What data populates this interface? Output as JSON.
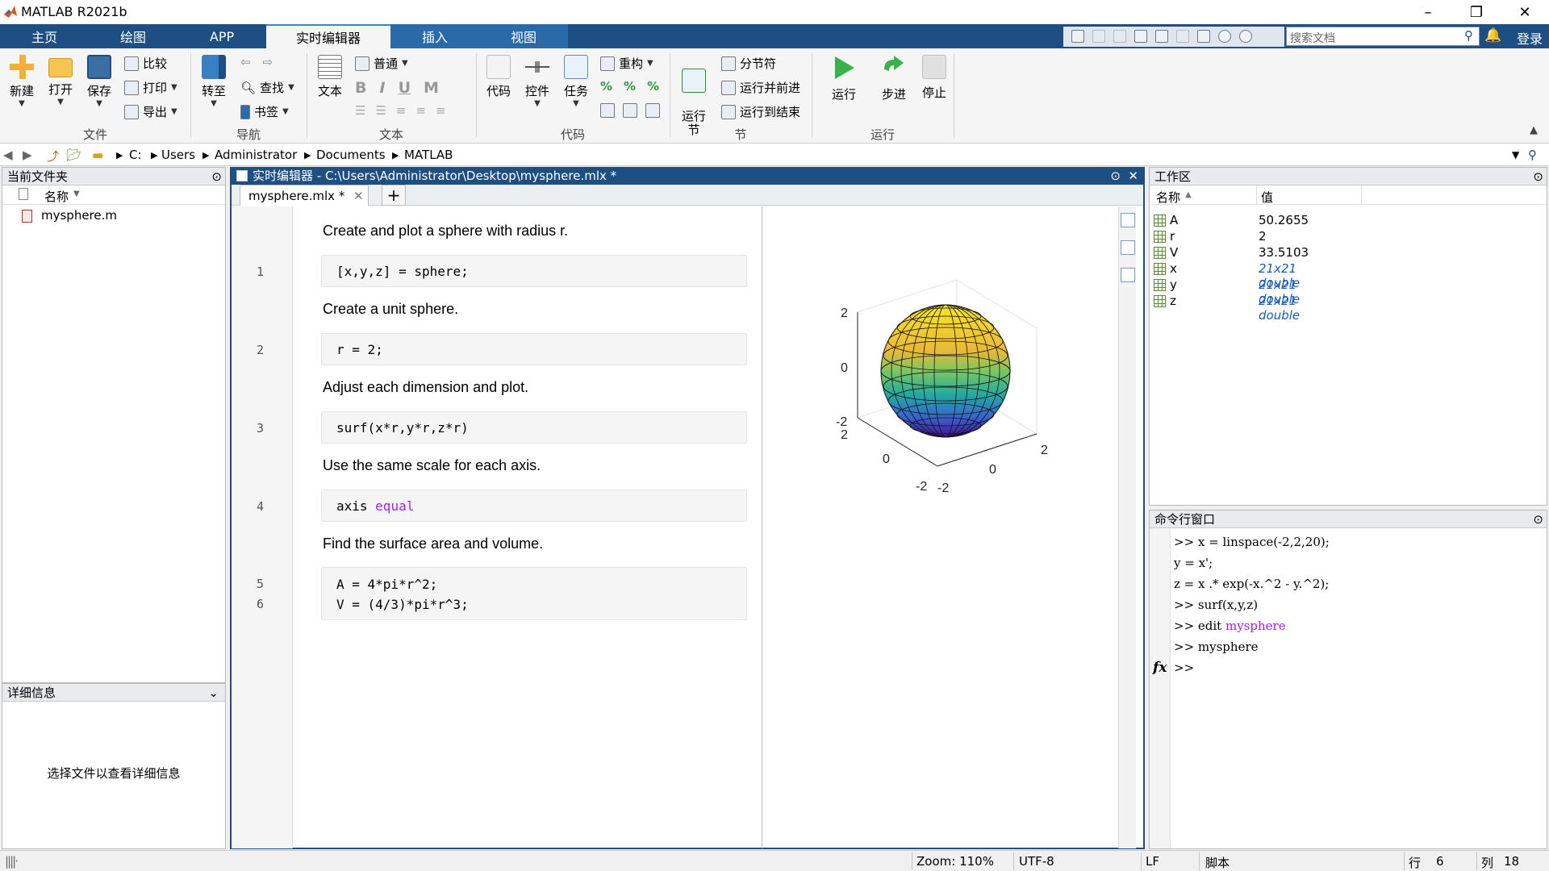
{
  "window": {
    "title": "MATLAB R2021b"
  },
  "tabs": [
    "主页",
    "绘图",
    "APP",
    "实时编辑器",
    "插入",
    "视图"
  ],
  "search": {
    "placeholder": "搜索文档"
  },
  "login_label": "登录",
  "ribbon": {
    "file": {
      "group": "文件",
      "new": "新建",
      "open": "打开",
      "save": "保存",
      "compare": "比较",
      "print": "打印",
      "export": "导出"
    },
    "nav": {
      "group": "导航",
      "goto": "转至",
      "find": "查找",
      "bookmark": "书签"
    },
    "text": {
      "group": "文本",
      "text_btn": "文本",
      "style": "普通",
      "bold": "B",
      "italic": "I",
      "underline": "U",
      "mono": "M"
    },
    "code": {
      "group": "代码",
      "code": "代码",
      "control": "控件",
      "task": "任务",
      "refactor": "重构"
    },
    "section": {
      "group": "节",
      "run_section": "运行\n节",
      "section_break": "分节符",
      "run_advance": "运行并前进",
      "run_to_end": "运行到结束"
    },
    "run": {
      "group": "运行",
      "run": "运行",
      "step": "步进",
      "stop": "停止"
    }
  },
  "address": {
    "drive": "C:",
    "parts": [
      "Users",
      "Administrator",
      "Documents",
      "MATLAB"
    ]
  },
  "current_folder": {
    "title": "当前文件夹",
    "col_name": "名称",
    "files": [
      "mysphere.m"
    ],
    "details_title": "详细信息",
    "details_msg": "选择文件以查看详细信息"
  },
  "editor": {
    "title": "实时编辑器 - C:\\Users\\Administrator\\Desktop\\mysphere.mlx *",
    "tab": "mysphere.mlx *",
    "cells": [
      {
        "text": "Create and plot a sphere with radius r.",
        "lines": [
          "1"
        ],
        "code": [
          "[x,y,z] = sphere;"
        ]
      },
      {
        "text": "Create a unit sphere.",
        "lines": [
          "2"
        ],
        "code": [
          "r = 2;"
        ]
      },
      {
        "text": "Adjust each dimension and plot.",
        "lines": [
          "3"
        ],
        "code": [
          "surf(x*r,y*r,z*r)"
        ]
      },
      {
        "text": "Use the same scale for each axis.",
        "lines": [
          "4"
        ],
        "code_pre": "axis ",
        "code_kw": "equal"
      },
      {
        "text": "Find the surface area and volume.",
        "lines": [
          "5",
          "6"
        ],
        "code": [
          "A = 4*pi*r^2;",
          "V = (4/3)*pi*r^3;"
        ]
      }
    ],
    "plot_ticks": {
      "z": [
        "2",
        "0",
        "-2"
      ],
      "x": [
        "2",
        "0",
        "-2"
      ],
      "y": [
        "2",
        "0",
        "-2"
      ]
    }
  },
  "workspace": {
    "title": "工作区",
    "col_name": "名称",
    "col_value": "值",
    "vars": [
      {
        "name": "A",
        "value": "50.2655",
        "italic": false
      },
      {
        "name": "r",
        "value": "2",
        "italic": false
      },
      {
        "name": "V",
        "value": "33.5103",
        "italic": false
      },
      {
        "name": "x",
        "value": "21x21 double",
        "italic": true
      },
      {
        "name": "y",
        "value": "21x21 double",
        "italic": true
      },
      {
        "name": "z",
        "value": "21x21 double",
        "italic": true
      }
    ]
  },
  "command": {
    "title": "命令行窗口",
    "lines": [
      ">> x = linspace(-2,2,20);",
      "y = x';",
      "z = x .* exp(-x.^2 - y.^2);",
      ">> surf(x,y,z)",
      ">> edit mysphere",
      ">> mysphere"
    ],
    "prompt": ">>",
    "fx": "fx"
  },
  "status": {
    "zoom": "Zoom: 110%",
    "encoding": "UTF-8",
    "eol": "LF",
    "type": "脚本",
    "row_label": "行",
    "row": "6",
    "col_label": "列",
    "col": "18"
  },
  "colors": {
    "tabbar": "#1e4f83",
    "keyword": "#a020f0"
  }
}
